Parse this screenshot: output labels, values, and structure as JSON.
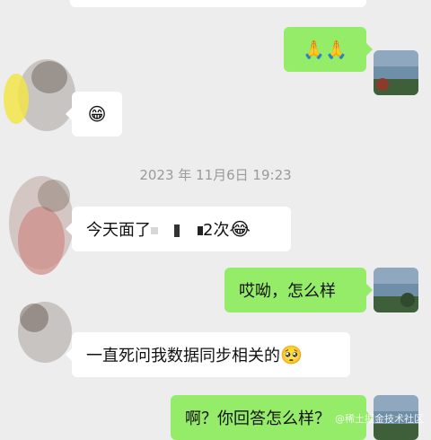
{
  "timestamp": "2023 年 11月6日 19:23",
  "messages": [
    {
      "side": "out",
      "text": "🙏🙏"
    },
    {
      "side": "in",
      "text": "😁"
    },
    {
      "side": "in",
      "text_start": "今天面了",
      "text_end": "2次",
      "emoji": "😂"
    },
    {
      "side": "out",
      "text": "哎呦，怎么样"
    },
    {
      "side": "in",
      "text": "一直死问我数据同步相关的",
      "emoji": "🥺"
    },
    {
      "side": "out",
      "text": "啊？你回答怎么样？"
    }
  ],
  "watermark": "@稀土掘金技术社区"
}
